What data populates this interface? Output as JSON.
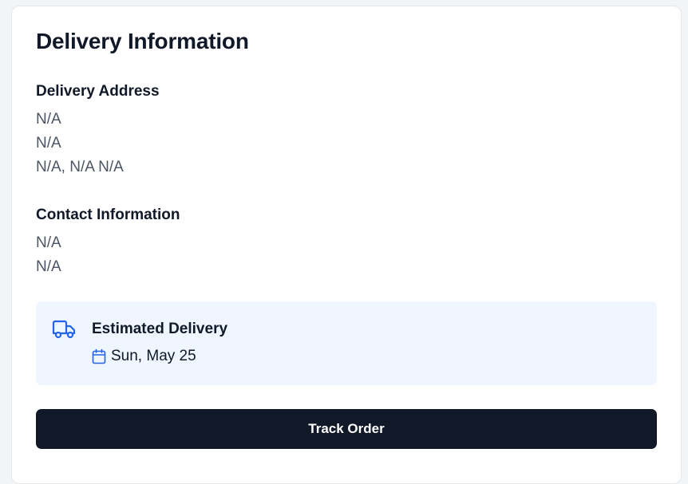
{
  "card": {
    "title": "Delivery Information"
  },
  "address": {
    "heading": "Delivery Address",
    "line1": "N/A",
    "line2": "N/A",
    "line3": "N/A, N/A N/A"
  },
  "contact": {
    "heading": "Contact Information",
    "line1": "N/A",
    "line2": "N/A"
  },
  "estimate": {
    "heading": "Estimated Delivery",
    "date": "Sun, May 25",
    "icon": "truck-icon",
    "date_icon": "calendar-icon",
    "accent": "#2563eb",
    "background": "#eff6ff"
  },
  "actions": {
    "track_label": "Track Order",
    "button_color": "#111827"
  }
}
